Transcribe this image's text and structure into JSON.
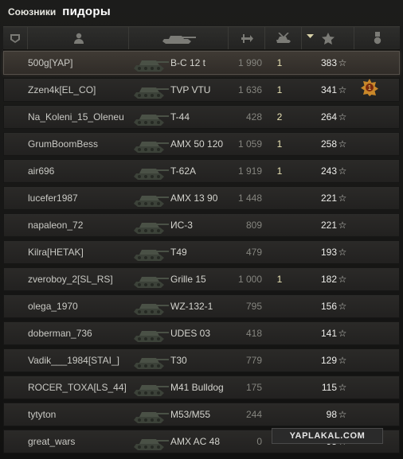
{
  "title": {
    "team_label": "Союзники",
    "team_name": "пидоры"
  },
  "columns": [
    {
      "icon": "squad-icon"
    },
    {
      "icon": "player-icon"
    },
    {
      "icon": "tank-icon"
    },
    {
      "icon": "damage-icon"
    },
    {
      "icon": "kills-icon"
    },
    {
      "icon": "experience-star-icon"
    },
    {
      "icon": "medal-icon"
    }
  ],
  "star_glyph": "☆",
  "rows": [
    {
      "player": "500g[YAP]",
      "vehicle": "B-C 12 t",
      "damage": "1 990",
      "kills": "1",
      "xp": "383",
      "highlight": true,
      "medal": ""
    },
    {
      "player": "Zzen4k[EL_CO]",
      "vehicle": "TVP VTU",
      "damage": "1 636",
      "kills": "1",
      "xp": "341",
      "highlight": false,
      "medal": "achievement-medal-icon"
    },
    {
      "player": "Na_Koleni_15_Oleneu",
      "vehicle": "T-44",
      "damage": "428",
      "kills": "2",
      "xp": "264",
      "highlight": false,
      "medal": ""
    },
    {
      "player": "GrumBoomBess",
      "vehicle": "AMX 50 120",
      "damage": "1 059",
      "kills": "1",
      "xp": "258",
      "highlight": false,
      "medal": ""
    },
    {
      "player": "air696",
      "vehicle": "T-62A",
      "damage": "1 919",
      "kills": "1",
      "xp": "243",
      "highlight": false,
      "medal": ""
    },
    {
      "player": "lucefer1987",
      "vehicle": "AMX 13 90",
      "damage": "1 448",
      "kills": "",
      "xp": "221",
      "highlight": false,
      "medal": ""
    },
    {
      "player": "napaleon_72",
      "vehicle": "ИС-3",
      "damage": "809",
      "kills": "",
      "xp": "221",
      "highlight": false,
      "medal": ""
    },
    {
      "player": "Kilra[HETAK]",
      "vehicle": "T49",
      "damage": "479",
      "kills": "",
      "xp": "193",
      "highlight": false,
      "medal": ""
    },
    {
      "player": "zveroboy_2[SL_RS]",
      "vehicle": "Grille 15",
      "damage": "1 000",
      "kills": "1",
      "xp": "182",
      "highlight": false,
      "medal": ""
    },
    {
      "player": "olega_1970",
      "vehicle": "WZ-132-1",
      "damage": "795",
      "kills": "",
      "xp": "156",
      "highlight": false,
      "medal": ""
    },
    {
      "player": "doberman_736",
      "vehicle": "UDES 03",
      "damage": "418",
      "kills": "",
      "xp": "141",
      "highlight": false,
      "medal": ""
    },
    {
      "player": "Vadik___1984[STAI_]",
      "vehicle": "T30",
      "damage": "779",
      "kills": "",
      "xp": "129",
      "highlight": false,
      "medal": ""
    },
    {
      "player": "ROCER_TOXA[LS_44]",
      "vehicle": "M41 Bulldog",
      "damage": "175",
      "kills": "",
      "xp": "115",
      "highlight": false,
      "medal": ""
    },
    {
      "player": "tytyton",
      "vehicle": "M53/M55",
      "damage": "244",
      "kills": "",
      "xp": "98",
      "highlight": false,
      "medal": ""
    },
    {
      "player": "great_wars",
      "vehicle": "AMX AC 48",
      "damage": "0",
      "kills": "",
      "xp": "95",
      "highlight": false,
      "medal": ""
    }
  ],
  "watermark": "YAPLAKAL.COM"
}
